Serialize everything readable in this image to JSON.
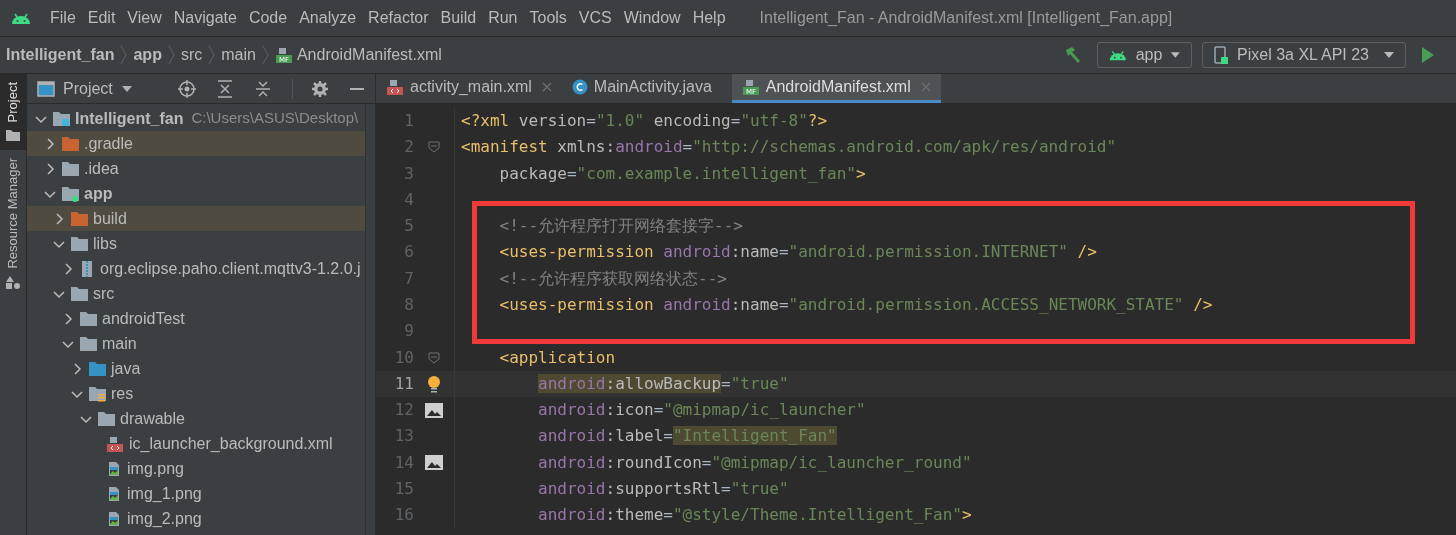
{
  "menu_bar": {
    "items": [
      {
        "label": "File"
      },
      {
        "label": "Edit"
      },
      {
        "label": "View"
      },
      {
        "label": "Navigate"
      },
      {
        "label": "Code"
      },
      {
        "label": "Analyze"
      },
      {
        "label": "Refactor"
      },
      {
        "label": "Build"
      },
      {
        "label": "Run"
      },
      {
        "label": "Tools"
      },
      {
        "label": "VCS"
      },
      {
        "label": "Window"
      },
      {
        "label": "Help"
      }
    ]
  },
  "window": {
    "title": "Intelligent_Fan - AndroidManifest.xml [Intelligent_Fan.app]"
  },
  "breadcrumbs": [
    {
      "label": "Intelligent_fan",
      "bold": true
    },
    {
      "label": "app",
      "bold": true
    },
    {
      "label": "src",
      "bold": false
    },
    {
      "label": "main",
      "bold": false
    },
    {
      "label": "AndroidManifest.xml",
      "bold": false,
      "kind": "manifest",
      "badge": "MF"
    }
  ],
  "run_toolbar": {
    "config": "app",
    "device": "Pixel 3a XL API 23"
  },
  "side_strip": {
    "tabs": [
      {
        "label": "Project",
        "selected": true
      },
      {
        "label": "Resource Manager",
        "selected": false
      }
    ]
  },
  "project_panel": {
    "title": "Project",
    "tree": [
      {
        "label": "Intelligent_fan",
        "kind": "project",
        "expanded": true,
        "path": "C:\\Users\\ASUS\\Desktop\\",
        "children": [
          {
            "label": ".gradle",
            "kind": "excluded",
            "expanded": false
          },
          {
            "label": ".idea",
            "kind": "folder",
            "expanded": false
          },
          {
            "label": "app",
            "kind": "module",
            "expanded": true,
            "children": [
              {
                "label": "build",
                "kind": "excluded",
                "expanded": false
              },
              {
                "label": "libs",
                "kind": "folder",
                "expanded": true,
                "children": [
                  {
                    "label": "org.eclipse.paho.client.mqttv3-1.2.0.j",
                    "kind": "jar",
                    "expanded": false
                  }
                ]
              },
              {
                "label": "src",
                "kind": "folder",
                "expanded": true,
                "children": [
                  {
                    "label": "androidTest",
                    "kind": "folder",
                    "expanded": false
                  },
                  {
                    "label": "main",
                    "kind": "folder",
                    "expanded": true,
                    "children": [
                      {
                        "label": "java",
                        "kind": "source",
                        "expanded": false
                      },
                      {
                        "label": "res",
                        "kind": "res",
                        "expanded": true,
                        "children": [
                          {
                            "label": "drawable",
                            "kind": "folder",
                            "expanded": true,
                            "children": [
                              {
                                "label": "ic_launcher_background.xml",
                                "kind": "xml"
                              },
                              {
                                "label": "img.png",
                                "kind": "image"
                              },
                              {
                                "label": "img_1.png",
                                "kind": "image"
                              },
                              {
                                "label": "img_2.png",
                                "kind": "image"
                              }
                            ]
                          }
                        ]
                      }
                    ]
                  }
                ]
              }
            ]
          }
        ]
      }
    ]
  },
  "editor_tabs": [
    {
      "label": "activity_main.xml",
      "kind": "xml",
      "selected": false,
      "closable": true
    },
    {
      "label": "MainActivity.java",
      "kind": "class",
      "selected": false,
      "closable": false
    },
    {
      "label": "AndroidManifest.xml",
      "kind": "manifest",
      "badge": "MF",
      "selected": true,
      "closable": true
    }
  ],
  "editor": {
    "lines": [
      {
        "number": "1",
        "current": false,
        "annotated": false,
        "segments": [
          {
            "t": "<?xml ",
            "kind": "tag"
          },
          {
            "t": "version",
            "kind": "attr"
          },
          {
            "t": "=",
            "kind": "punct"
          },
          {
            "t": "\"1.0\"",
            "kind": "str"
          },
          {
            "t": " encoding",
            "kind": "attr"
          },
          {
            "t": "=",
            "kind": "punct"
          },
          {
            "t": "\"utf-8\"",
            "kind": "str"
          },
          {
            "t": "?>",
            "kind": "tag"
          }
        ]
      },
      {
        "number": "2",
        "gutter": {
          "kind": "fold"
        },
        "current": false,
        "annotated": false,
        "segments": [
          {
            "t": "<manifest ",
            "kind": "tag"
          },
          {
            "t": "xmlns:",
            "kind": "attr"
          },
          {
            "t": "android",
            "kind": "ns"
          },
          {
            "t": "=",
            "kind": "punct"
          },
          {
            "t": "\"http://schemas.android.com/apk/res/android\"",
            "kind": "str"
          }
        ],
        "children": [
          {
            "number": "3",
            "current": false,
            "annotated": false,
            "segments": [
              {
                "t": "package",
                "kind": "attr"
              },
              {
                "t": "=",
                "kind": "punct"
              },
              {
                "t": "\"com.example.intelligent_fan\"",
                "kind": "str"
              },
              {
                "t": ">",
                "kind": "tag"
              }
            ]
          },
          {
            "number": "4",
            "current": false,
            "annotated": false
          },
          {
            "number": "5",
            "current": false,
            "annotated": true,
            "segments": [
              {
                "t": "<!--允许程序打开网络套接字-->",
                "kind": "comment"
              }
            ]
          },
          {
            "number": "6",
            "current": false,
            "annotated": true,
            "segments": [
              {
                "t": "<uses-permission ",
                "kind": "tag"
              },
              {
                "t": "android",
                "kind": "ns"
              },
              {
                "t": ":name",
                "kind": "attr"
              },
              {
                "t": "=",
                "kind": "punct"
              },
              {
                "t": "\"android.permission.INTERNET\"",
                "kind": "str"
              },
              {
                "t": " />",
                "kind": "tag"
              }
            ]
          },
          {
            "number": "7",
            "current": false,
            "annotated": true,
            "segments": [
              {
                "t": "<!--允许程序获取网络状态-->",
                "kind": "comment"
              }
            ]
          },
          {
            "number": "8",
            "current": false,
            "annotated": true,
            "segments": [
              {
                "t": "<uses-permission ",
                "kind": "tag"
              },
              {
                "t": "android",
                "kind": "ns"
              },
              {
                "t": ":name",
                "kind": "attr"
              },
              {
                "t": "=",
                "kind": "punct"
              },
              {
                "t": "\"android.permission.ACCESS_NETWORK_STATE\"",
                "kind": "str"
              },
              {
                "t": " />",
                "kind": "tag"
              }
            ]
          },
          {
            "number": "9",
            "current": false,
            "annotated": true
          },
          {
            "number": "10",
            "gutter": {
              "kind": "fold"
            },
            "current": false,
            "annotated": false,
            "segments": [
              {
                "t": "<application",
                "kind": "tag"
              }
            ],
            "children": [
              {
                "number": "11",
                "gutter": {
                  "kind": "bulb"
                },
                "current": true,
                "annotated": false,
                "segments": [
                  {
                    "t": "android",
                    "kind": "ns",
                    "highlight": true
                  },
                  {
                    "t": ":allowBackup",
                    "kind": "attr",
                    "highlight": true
                  },
                  {
                    "t": "=",
                    "kind": "punct"
                  },
                  {
                    "t": "\"true\"",
                    "kind": "str"
                  }
                ]
              },
              {
                "number": "12",
                "gutter": {
                  "kind": "image"
                },
                "current": false,
                "annotated": false,
                "segments": [
                  {
                    "t": "android",
                    "kind": "ns"
                  },
                  {
                    "t": ":icon",
                    "kind": "attr"
                  },
                  {
                    "t": "=",
                    "kind": "punct"
                  },
                  {
                    "t": "\"@mipmap/ic_launcher\"",
                    "kind": "str"
                  }
                ]
              },
              {
                "number": "13",
                "current": false,
                "annotated": false,
                "segments": [
                  {
                    "t": "android",
                    "kind": "ns"
                  },
                  {
                    "t": ":label",
                    "kind": "attr"
                  },
                  {
                    "t": "=",
                    "kind": "punct"
                  },
                  {
                    "t": "\"Intelligent_Fan\"",
                    "kind": "str",
                    "highlight": true
                  }
                ]
              },
              {
                "number": "14",
                "gutter": {
                  "kind": "image"
                },
                "current": false,
                "annotated": false,
                "segments": [
                  {
                    "t": "android",
                    "kind": "ns"
                  },
                  {
                    "t": ":roundIcon",
                    "kind": "attr"
                  },
                  {
                    "t": "=",
                    "kind": "punct"
                  },
                  {
                    "t": "\"@mipmap/ic_launcher_round\"",
                    "kind": "str"
                  }
                ]
              },
              {
                "number": "15",
                "current": false,
                "annotated": false,
                "segments": [
                  {
                    "t": "android",
                    "kind": "ns"
                  },
                  {
                    "t": ":supportsRtl",
                    "kind": "attr"
                  },
                  {
                    "t": "=",
                    "kind": "punct"
                  },
                  {
                    "t": "\"true\"",
                    "kind": "str"
                  }
                ]
              },
              {
                "number": "16",
                "current": false,
                "annotated": false,
                "segments": [
                  {
                    "t": "android",
                    "kind": "ns"
                  },
                  {
                    "t": ":theme",
                    "kind": "attr"
                  },
                  {
                    "t": "=",
                    "kind": "punct"
                  },
                  {
                    "t": "\"@style/Theme.Intelligent_Fan\"",
                    "kind": "str"
                  },
                  {
                    "t": ">",
                    "kind": "tag"
                  }
                ]
              }
            ]
          }
        ]
      }
    ],
    "annotation": {
      "color": "#f03a3a"
    }
  }
}
